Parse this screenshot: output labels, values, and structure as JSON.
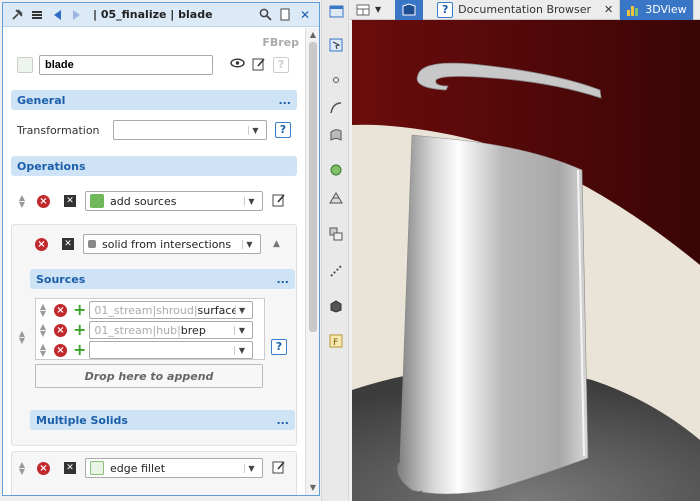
{
  "top_toolbar": {
    "icons": [
      "pin-icon",
      "menu-icon",
      "back-arrow-icon",
      "forward-arrow-icon",
      "window-icon",
      "layout-icon",
      "view-icon"
    ]
  },
  "panel": {
    "title": "| 05_finalize | blade",
    "fbrep_label": "FBrep",
    "name_value": "blade",
    "general": {
      "header": "General",
      "transformation_label": "Transformation",
      "transformation_value": ""
    },
    "operations": {
      "header": "Operations",
      "items": [
        {
          "label": "add sources"
        },
        {
          "label": "solid from intersections"
        }
      ],
      "last_item": {
        "label": "edge fillet"
      }
    },
    "sources": {
      "header": "Sources",
      "rows": [
        {
          "prefix": "01_stream|shroud|",
          "value": "surface"
        },
        {
          "prefix": "01_stream|hub|",
          "value": "brep"
        },
        {
          "prefix": "",
          "value": ""
        }
      ],
      "drop_label": "Drop here to append"
    },
    "multiple_solids": {
      "header": "Multiple Solids"
    },
    "more_label": "..."
  },
  "tabs": [
    {
      "label": "Documentation Browser",
      "close": "✕"
    },
    {
      "label": "3DView"
    }
  ],
  "colors": {
    "accent": "#3a76c6",
    "section_bg": "#cfe3f6",
    "section_text": "#1b5faa",
    "shroud": "#5b0a0a",
    "delete": "#c0292e",
    "add": "#3ea12c"
  }
}
